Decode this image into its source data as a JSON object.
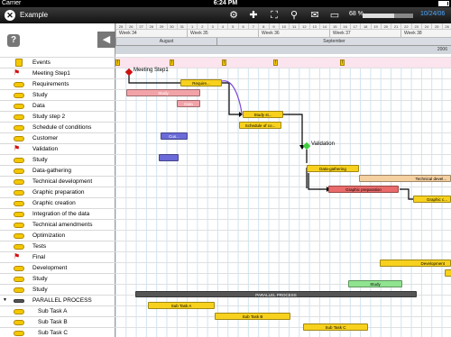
{
  "status": {
    "carrier": "Carrier",
    "time": "6:24 PM"
  },
  "toolbar": {
    "title": "Example",
    "zoom": "68 %",
    "date": "10/24/06",
    "close_glyph": "✕",
    "icons": [
      "gear-icon",
      "plus-icon",
      "crop-icon",
      "search-icon",
      "mail-icon",
      "monitor-icon"
    ]
  },
  "left": {
    "help_glyph": "?",
    "nav_glyph": "◀",
    "rows": [
      {
        "label": "Events",
        "icon": "warning-icon"
      },
      {
        "label": "Meeting Step1",
        "icon": "flag-icon"
      },
      {
        "label": "Requirements",
        "icon": "task-icon"
      },
      {
        "label": "Study",
        "icon": "task-icon"
      },
      {
        "label": "Data",
        "icon": "task-icon"
      },
      {
        "label": "Study step 2",
        "icon": "task-icon"
      },
      {
        "label": "Schedule of conditions",
        "icon": "task-icon"
      },
      {
        "label": "Customer",
        "icon": "task-icon"
      },
      {
        "label": "Validation",
        "icon": "flag-icon"
      },
      {
        "label": "Study",
        "icon": "task-icon"
      },
      {
        "label": "Data-gathering",
        "icon": "task-icon"
      },
      {
        "label": "Technical development",
        "icon": "task-icon"
      },
      {
        "label": "Graphic preparation",
        "icon": "task-icon"
      },
      {
        "label": "Graphic creation",
        "icon": "task-icon"
      },
      {
        "label": "Integration of the data",
        "icon": "task-icon"
      },
      {
        "label": "Technical amendments",
        "icon": "task-icon"
      },
      {
        "label": "Optimization",
        "icon": "task-icon"
      },
      {
        "label": "Tests",
        "icon": "task-icon"
      },
      {
        "label": "Final",
        "icon": "flag-icon"
      },
      {
        "label": "Development",
        "icon": "task-icon"
      },
      {
        "label": "Study",
        "icon": "task-icon"
      },
      {
        "label": "Study",
        "icon": "task-icon"
      },
      {
        "label": "PARALLEL PROCESS",
        "icon": "group-icon"
      },
      {
        "label": "Sub Task A",
        "icon": "task-icon"
      },
      {
        "label": "Sub Task B",
        "icon": "task-icon"
      },
      {
        "label": "Sub Task C",
        "icon": "task-icon"
      }
    ]
  },
  "timeline": {
    "days": [
      "25",
      "26",
      "27",
      "28",
      "29",
      "30",
      "31",
      "1",
      "2",
      "3",
      "4",
      "5",
      "6",
      "7",
      "8",
      "9",
      "10",
      "11",
      "12",
      "13",
      "14",
      "15",
      "16",
      "17",
      "18",
      "19",
      "20",
      "21",
      "22",
      "23",
      "24",
      "25",
      "26"
    ],
    "weeks": [
      "Week 34",
      "Week 35",
      "Week 36",
      "Week 37",
      "Week 38"
    ],
    "months": [
      "August",
      "September"
    ],
    "year": "2006"
  },
  "bars": {
    "meeting": "Meeting Step1",
    "requirements": "Require...",
    "study1": "Study",
    "data": "Data",
    "study2": "Study st...",
    "schedule": "Schedule of co...",
    "customer": "Cus...",
    "validation": "Validation",
    "datagathering": "Data-gathering",
    "techdev": "Technical devel...",
    "graphicprep": "Graphic preparation",
    "graphiccreation": "Graphic c...",
    "development": "Development",
    "study4": "Study",
    "parallel": "PARALLEL PROCESS",
    "suba": "Sub Task A",
    "subb": "Sub Task B",
    "subc": "Sub Task C",
    "event_glyph": "!"
  },
  "colors": {
    "accent": "#4aa8ff",
    "task": "#f7d11e",
    "milestone": "#d01010"
  }
}
